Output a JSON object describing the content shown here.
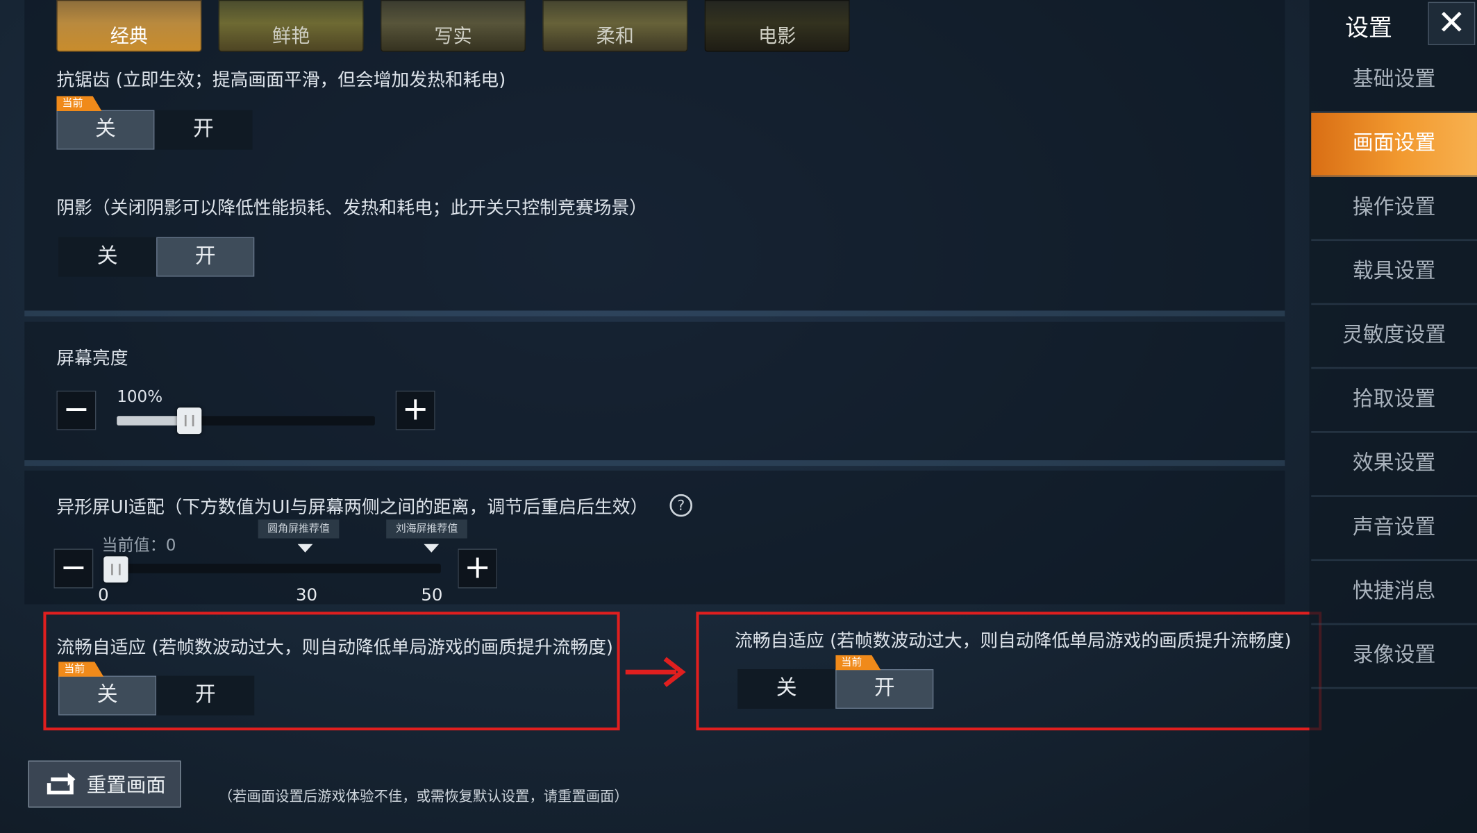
{
  "presets": [
    {
      "label": "经典",
      "active": true
    },
    {
      "label": "鲜艳",
      "active": false
    },
    {
      "label": "写实",
      "active": false
    },
    {
      "label": "柔和",
      "active": false
    },
    {
      "label": "电影",
      "active": false
    }
  ],
  "anti_aliasing": {
    "label": "抗锯齿 (立即生效；提高画面平滑，但会增加发热和耗电)",
    "badge": "当前",
    "off": "关",
    "on": "开",
    "selected": "off"
  },
  "shadow": {
    "label": "阴影（关闭阴影可以降低性能损耗、发热和耗电；此开关只控制竞赛场景）",
    "off": "关",
    "on": "开",
    "selected": "on"
  },
  "brightness": {
    "label": "屏幕亮度",
    "value_text": "100%",
    "value_fraction": 0.28,
    "minus": "−",
    "plus": "+"
  },
  "notch": {
    "label": "异形屏UI适配（下方数值为UI与屏幕两侧之间的距离，调节后重启后生效）",
    "help": "?",
    "current": "当前值：0",
    "marker1": "圆角屏推荐值",
    "marker2": "刘海屏推荐值",
    "ticks": [
      "0",
      "30",
      "50"
    ],
    "value": 0,
    "max": 50,
    "minus": "−",
    "plus": "+"
  },
  "smooth_left": {
    "label": "流畅自适应 (若帧数波动过大，则自动降低单局游戏的画质提升流畅度)",
    "badge": "当前",
    "off": "关",
    "on": "开",
    "selected": "off"
  },
  "smooth_right": {
    "label": "流畅自适应 (若帧数波动过大，则自动降低单局游戏的画质提升流畅度)",
    "badge": "当前",
    "off": "关",
    "on": "开",
    "selected": "on"
  },
  "reset": {
    "label": "重置画面",
    "note": "（若画面设置后游戏体验不佳，或需恢复默认设置，请重置画面）"
  },
  "sidebar": {
    "title": "设置",
    "close": "✕",
    "items": [
      {
        "label": "基础设置",
        "active": false
      },
      {
        "label": "画面设置",
        "active": true
      },
      {
        "label": "操作设置",
        "active": false
      },
      {
        "label": "载具设置",
        "active": false
      },
      {
        "label": "灵敏度设置",
        "active": false
      },
      {
        "label": "拾取设置",
        "active": false
      },
      {
        "label": "效果设置",
        "active": false
      },
      {
        "label": "声音设置",
        "active": false
      },
      {
        "label": "快捷消息",
        "active": false
      },
      {
        "label": "录像设置",
        "active": false
      }
    ]
  },
  "colors": {
    "accent": "#f29a30",
    "highlight_box": "#e01f1f"
  }
}
